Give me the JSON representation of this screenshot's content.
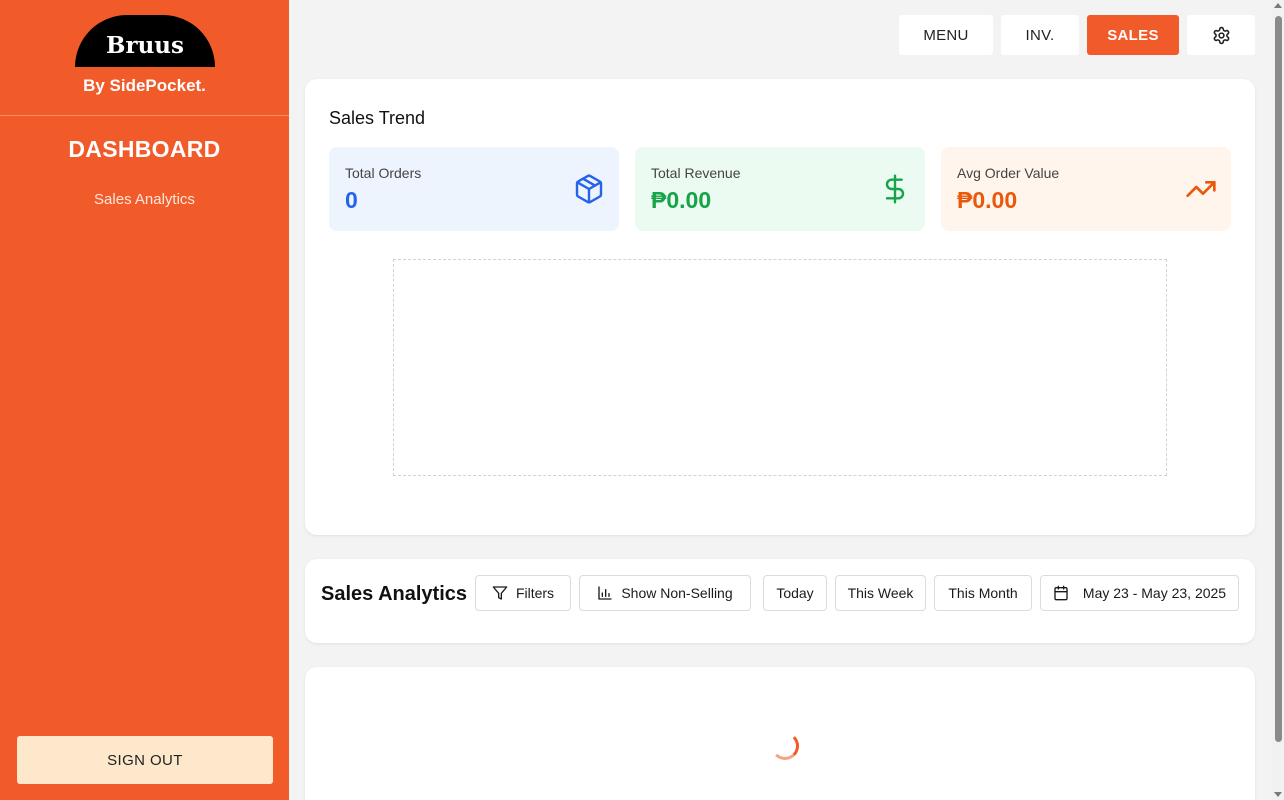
{
  "sidebar": {
    "logo": "Bruus",
    "byline": "By SidePocket.",
    "title": "DASHBOARD",
    "link": "Sales Analytics",
    "signout": "SIGN OUT"
  },
  "nav": {
    "menu": "MENU",
    "inv": "INV.",
    "sales": "SALES",
    "settings_icon": "gear-icon"
  },
  "trend": {
    "title": "Sales Trend",
    "stats": [
      {
        "label": "Total Orders",
        "value": "0",
        "color": "#2563eb",
        "bg": "#eef4fd",
        "icon": "package-icon"
      },
      {
        "label": "Total Revenue",
        "value": "₱0.00",
        "color": "#16a34a",
        "bg": "#ecfbf1",
        "icon": "dollar-icon"
      },
      {
        "label": "Avg Order Value",
        "value": "₱0.00",
        "color": "#ea580c",
        "bg": "#fff5ec",
        "icon": "trending-up-icon"
      }
    ]
  },
  "analytics": {
    "title": "Sales Analytics",
    "filters": "Filters",
    "non_selling": "Show Non-Selling",
    "today": "Today",
    "this_week": "This Week",
    "this_month": "This Month",
    "date_range": "May 23 - May 23, 2025"
  },
  "colors": {
    "accent": "#f15a29",
    "signout_bg": "#fde8cc"
  }
}
